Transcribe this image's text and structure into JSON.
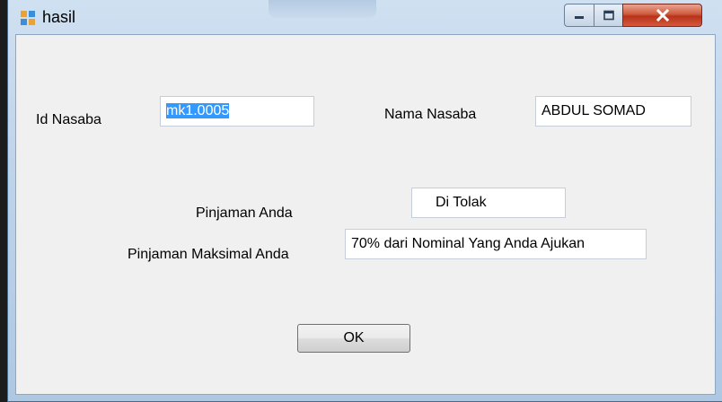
{
  "window": {
    "title": "hasil"
  },
  "form": {
    "id_label": "Id Nasaba",
    "id_value": "mk1.0005",
    "nama_label": "Nama Nasaba",
    "nama_value": "ABDUL SOMAD",
    "pinjaman_label": "Pinjaman Anda",
    "pinjaman_value": "Di Tolak",
    "maksimal_label": "Pinjaman Maksimal Anda",
    "maksimal_value": "70% dari Nominal Yang Anda Ajukan",
    "ok_label": "OK"
  },
  "colors": {
    "selection": "#3399ff",
    "close_button": "#c8452a",
    "client_bg": "#f0f0f0"
  }
}
